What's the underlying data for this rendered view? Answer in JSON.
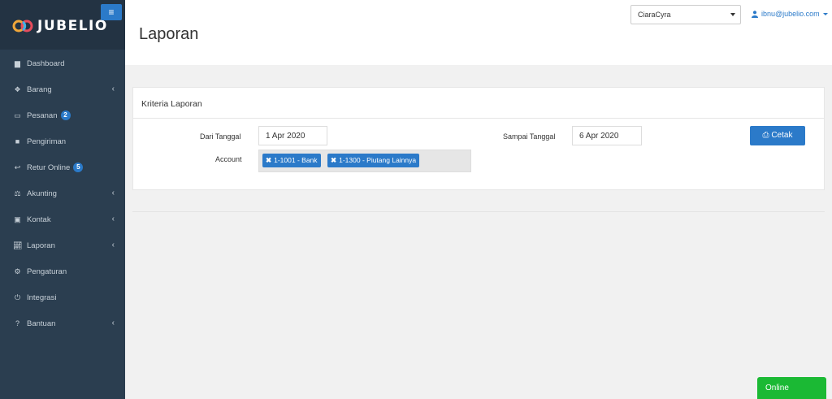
{
  "brand": {
    "name": "JUBELIO"
  },
  "sidebar": {
    "items": [
      {
        "label": "Dashboard",
        "icon": "dashboard-icon",
        "has_submenu": false
      },
      {
        "label": "Barang",
        "icon": "cubes-icon",
        "has_submenu": true
      },
      {
        "label": "Pesanan",
        "icon": "basket-icon",
        "has_submenu": false,
        "badge": "2"
      },
      {
        "label": "Pengiriman",
        "icon": "truck-icon",
        "has_submenu": false
      },
      {
        "label": "Retur Online",
        "icon": "reply-icon",
        "has_submenu": false,
        "badge": "5"
      },
      {
        "label": "Akunting",
        "icon": "balance-scale-icon",
        "has_submenu": true
      },
      {
        "label": "Kontak",
        "icon": "contact-card-icon",
        "has_submenu": true
      },
      {
        "label": "Laporan",
        "icon": "line-chart-icon",
        "has_submenu": true
      },
      {
        "label": "Pengaturan",
        "icon": "gears-icon",
        "has_submenu": false
      },
      {
        "label": "Integrasi",
        "icon": "plug-icon",
        "has_submenu": false
      },
      {
        "label": "Bantuan",
        "icon": "question-circle-icon",
        "has_submenu": true
      }
    ]
  },
  "header": {
    "title": "Laporan",
    "company": "CiaraCyra",
    "user_email": "ibnu@jubelio.com"
  },
  "panel": {
    "heading": "Kriteria Laporan",
    "from_label": "Dari Tanggal",
    "from_value": "1 Apr 2020",
    "to_label": "Sampai Tanggal",
    "to_value": "6 Apr 2020",
    "account_label": "Account",
    "accounts": [
      "1-1001 - Bank",
      "1-1300 - Piutang Lainnya"
    ],
    "print_label": "Cetak"
  },
  "status": {
    "online_label": "Online"
  },
  "colors": {
    "sidebar": "#2b3e50",
    "primary": "#2b7ac9",
    "online": "#1bb934"
  }
}
